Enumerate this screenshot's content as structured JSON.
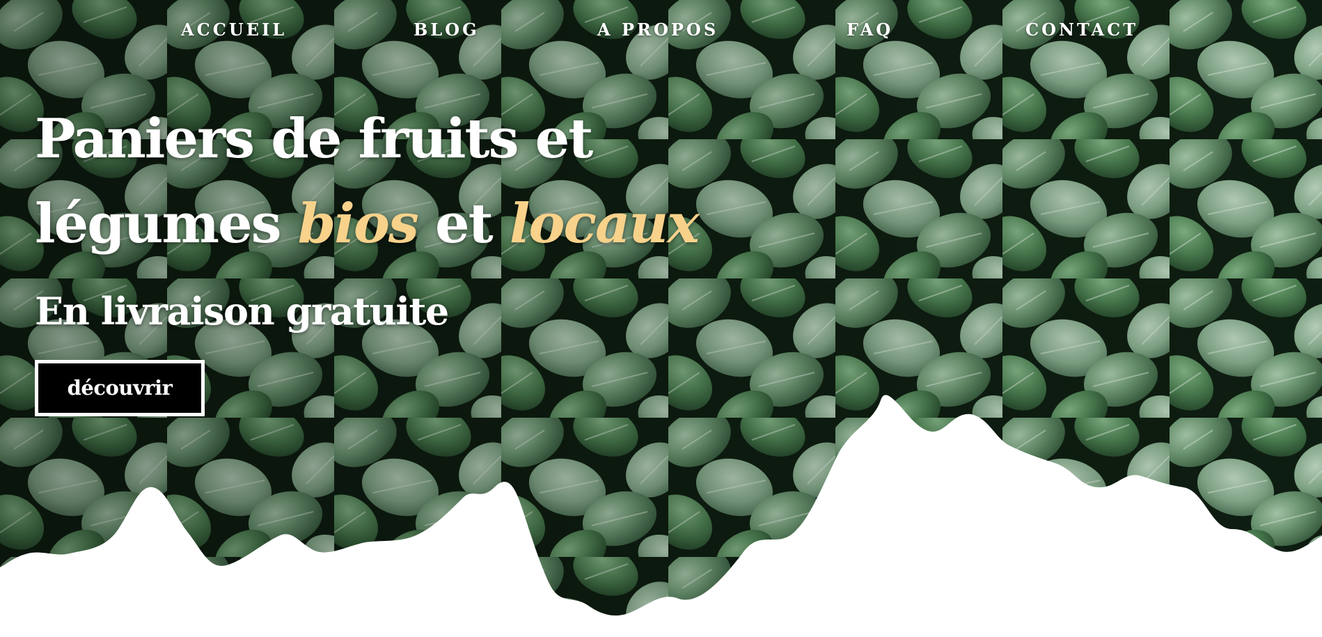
{
  "nav": {
    "items": [
      {
        "label": "ACCUEIL"
      },
      {
        "label": "BLOG"
      },
      {
        "label": "A PROPOS"
      },
      {
        "label": "FAQ"
      },
      {
        "label": "CONTACT"
      }
    ]
  },
  "hero": {
    "line1": "Paniers de fruits et",
    "line2_start": "légumes ",
    "accent1": "bios",
    "line2_mid": " et ",
    "accent2": "locaux",
    "subtitle": "En livraison gratuite",
    "cta_label": "découvrir",
    "background_image": "leafy-green-vegetables-photo"
  },
  "colors": {
    "accent": "#f8d28b",
    "text": "#ffffff",
    "button_bg": "#000000",
    "page_bg": "#ffffff",
    "leaf_dark": "#1e3a24",
    "leaf_mid": "#4d7a55",
    "leaf_light": "#8fb595"
  }
}
